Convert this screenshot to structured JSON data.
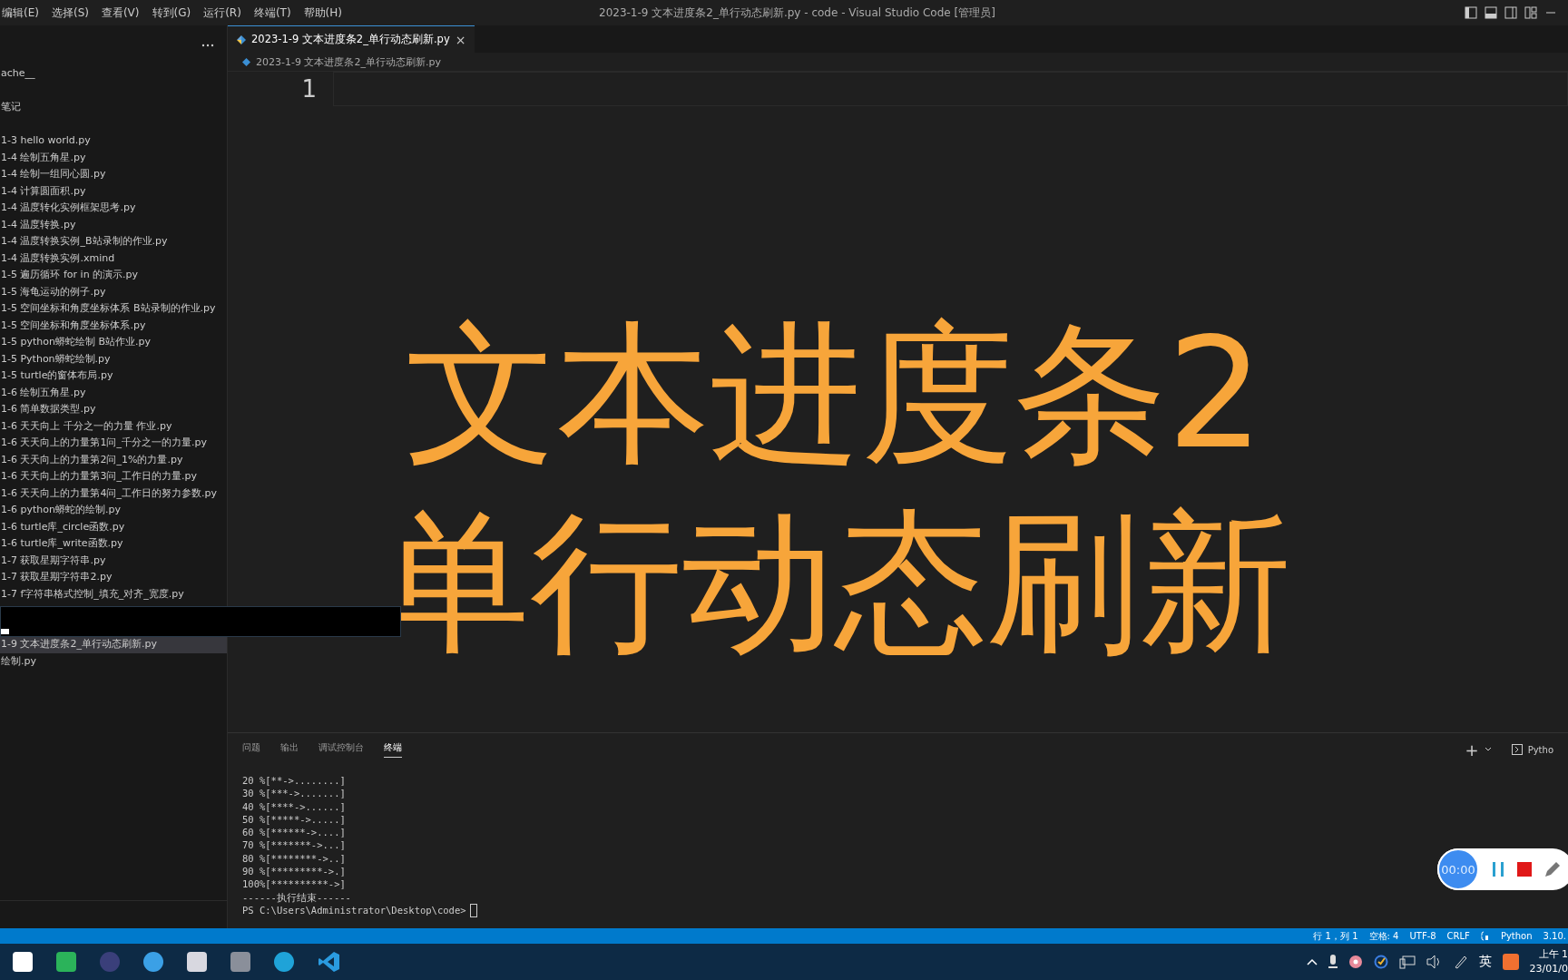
{
  "menu": [
    "编辑(E)",
    "选择(S)",
    "查看(V)",
    "转到(G)",
    "运行(R)",
    "终端(T)",
    "帮助(H)"
  ],
  "window": {
    "title": "2023-1-9 文本进度条2_单行动态刷新.py - code - Visual Studio Code [管理员]"
  },
  "sidebar": {
    "folders": [
      "ache__",
      "笔记"
    ],
    "files": [
      {
        "label": "1-3 hello world.py",
        "selected": false
      },
      {
        "label": "1-4 绘制五角星.py",
        "selected": false
      },
      {
        "label": "1-4 绘制一组同心圆.py",
        "selected": false
      },
      {
        "label": "1-4 计算圆面积.py",
        "selected": false
      },
      {
        "label": "1-4 温度转化实例框架思考.py",
        "selected": false
      },
      {
        "label": "1-4 温度转换.py",
        "selected": false
      },
      {
        "label": "1-4 温度转换实例_B站录制的作业.py",
        "selected": false
      },
      {
        "label": "1-4 温度转换实例.xmind",
        "selected": false
      },
      {
        "label": "1-5 遍历循环 for in 的演示.py",
        "selected": false
      },
      {
        "label": "1-5 海龟运动的例子.py",
        "selected": false
      },
      {
        "label": "1-5 空间坐标和角度坐标体系 B站录制的作业.py",
        "selected": false
      },
      {
        "label": "1-5 空间坐标和角度坐标体系.py",
        "selected": false
      },
      {
        "label": "1-5 python蟒蛇绘制 B站作业.py",
        "selected": false
      },
      {
        "label": "1-5 Python蟒蛇绘制.py",
        "selected": false
      },
      {
        "label": "1-5 turtle的窗体布局.py",
        "selected": false
      },
      {
        "label": "1-6 绘制五角星.py",
        "selected": false
      },
      {
        "label": "1-6 简单数据类型.py",
        "selected": false
      },
      {
        "label": "1-6 天天向上 千分之一的力量 作业.py",
        "selected": false
      },
      {
        "label": "1-6 天天向上的力量第1问_千分之一的力量.py",
        "selected": false
      },
      {
        "label": "1-6 天天向上的力量第2问_1%的力量.py",
        "selected": false
      },
      {
        "label": "1-6 天天向上的力量第3问_工作日的力量.py",
        "selected": false
      },
      {
        "label": "1-6 天天向上的力量第4问_工作日的努力参数.py",
        "selected": false
      },
      {
        "label": "1-6 python蟒蛇的绘制.py",
        "selected": false
      },
      {
        "label": "1-6 turtle库_circle函数.py",
        "selected": false
      },
      {
        "label": "1-6 turtle库_write函数.py",
        "selected": false
      },
      {
        "label": "1-7 获取星期字符串.py",
        "selected": false
      },
      {
        "label": "1-7 获取星期字符串2.py",
        "selected": false
      },
      {
        "label": "1-7 f字符串格式控制_填充_对齐_宽度.py",
        "selected": false
      }
    ],
    "files_below_cover": [
      {
        "label": "1-9 文本进度条2_单行动态刷新.py",
        "selected": true
      },
      {
        "label": "绘制.py",
        "selected": false
      }
    ]
  },
  "tab": {
    "label": "2023-1-9 文本进度条2_单行动态刷新.py",
    "close": "×"
  },
  "breadcrumb": "2023-1-9 文本进度条2_单行动态刷新.py",
  "editor": {
    "line_number": "1"
  },
  "overlay_title": [
    "文本进度条2",
    "单行动态刷新"
  ],
  "panel": {
    "tabs": [
      {
        "label": "问题",
        "selected": false
      },
      {
        "label": "输出",
        "selected": false
      },
      {
        "label": "调试控制台",
        "selected": false
      },
      {
        "label": "终端",
        "selected": true
      }
    ],
    "add": "+",
    "terminal_name": "Pytho",
    "lines": [
      "20 %[**->........]",
      "30 %[***->.......]",
      "40 %[****->......]",
      "50 %[*****->.....]",
      "60 %[******->....]",
      "70 %[*******->...]",
      "80 %[********->..]",
      "90 %[*********->.]",
      "100%[**********->]",
      "------执行结束------"
    ],
    "prompt": "PS C:\\Users\\Administrator\\Desktop\\code>"
  },
  "recorder": {
    "time": "00:00"
  },
  "status_bar": [
    "行 1，列 1",
    "空格: 4",
    "UTF-8",
    "CRLF",
    "Python",
    "3.10."
  ],
  "taskbar": {
    "input_method": "英",
    "time": "上午 1",
    "date": "23/01/0"
  }
}
